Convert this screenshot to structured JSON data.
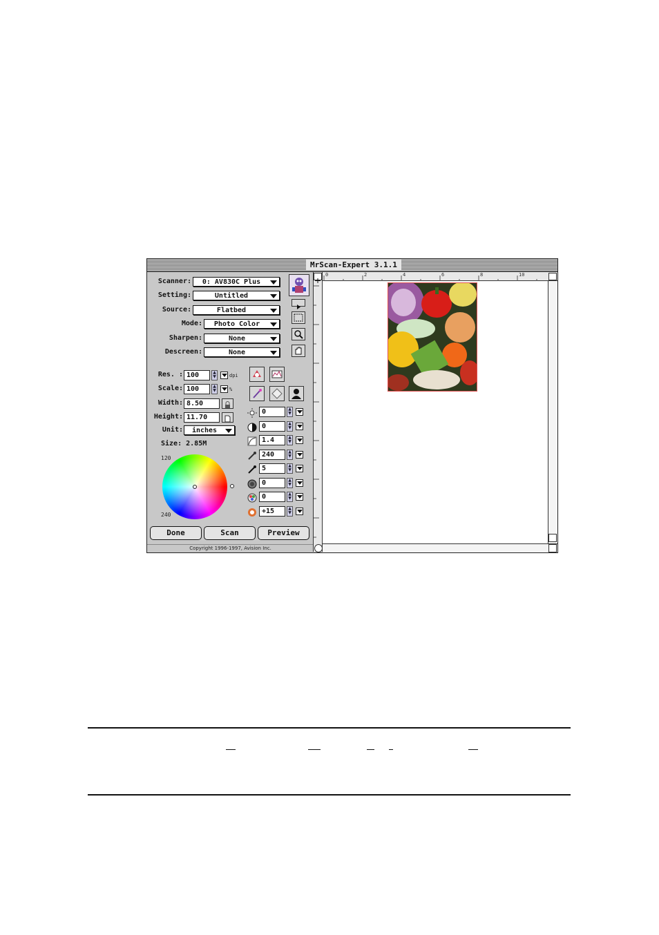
{
  "window": {
    "title": "MrScan-Expert 3.1.1"
  },
  "settings": {
    "scanner": {
      "label": "Scanner:",
      "value": "0: AV830C Plus"
    },
    "setting": {
      "label": "Setting:",
      "value": "Untitled"
    },
    "source": {
      "label": "Source:",
      "value": "Flatbed"
    },
    "mode": {
      "label": "Mode:",
      "value": "Photo Color"
    },
    "sharpen": {
      "label": "Sharpen:",
      "value": "None"
    },
    "descreen": {
      "label": "Descreen:",
      "value": "None"
    }
  },
  "dimensions": {
    "res": {
      "label": "Res. :",
      "value": "100",
      "unit": "dpi"
    },
    "scale": {
      "label": "Scale:",
      "value": "100",
      "unit": "%"
    },
    "width": {
      "label": "Width:",
      "value": "8.50"
    },
    "height": {
      "label": "Height:",
      "value": "11.70"
    },
    "unit": {
      "label": "Unit:",
      "value": "inches"
    },
    "size": "Size: 2.85M"
  },
  "color_wheel": {
    "label_top": "120",
    "label_bottom": "240"
  },
  "adjustments": [
    {
      "icon": "brightness-icon",
      "value": "0"
    },
    {
      "icon": "contrast-icon",
      "value": "0"
    },
    {
      "icon": "gamma-icon",
      "value": "1.4"
    },
    {
      "icon": "highlight-eyedropper-icon",
      "value": "240"
    },
    {
      "icon": "shadow-eyedropper-icon",
      "value": "5"
    },
    {
      "icon": "midtone-icon",
      "value": "0"
    },
    {
      "icon": "color-balance-icon",
      "value": "0"
    },
    {
      "icon": "saturation-icon",
      "value": "+15"
    }
  ],
  "buttons": {
    "done": "Done",
    "scan": "Scan",
    "preview": "Preview"
  },
  "copyright": "Copyright 1996-1997, Avision Inc.",
  "ruler": {
    "h_ticks": [
      "0",
      "2",
      "4",
      "6",
      "8",
      "10"
    ]
  },
  "colors": {
    "selection_border": "#e05050",
    "window_bg": "#c8c8c8"
  }
}
